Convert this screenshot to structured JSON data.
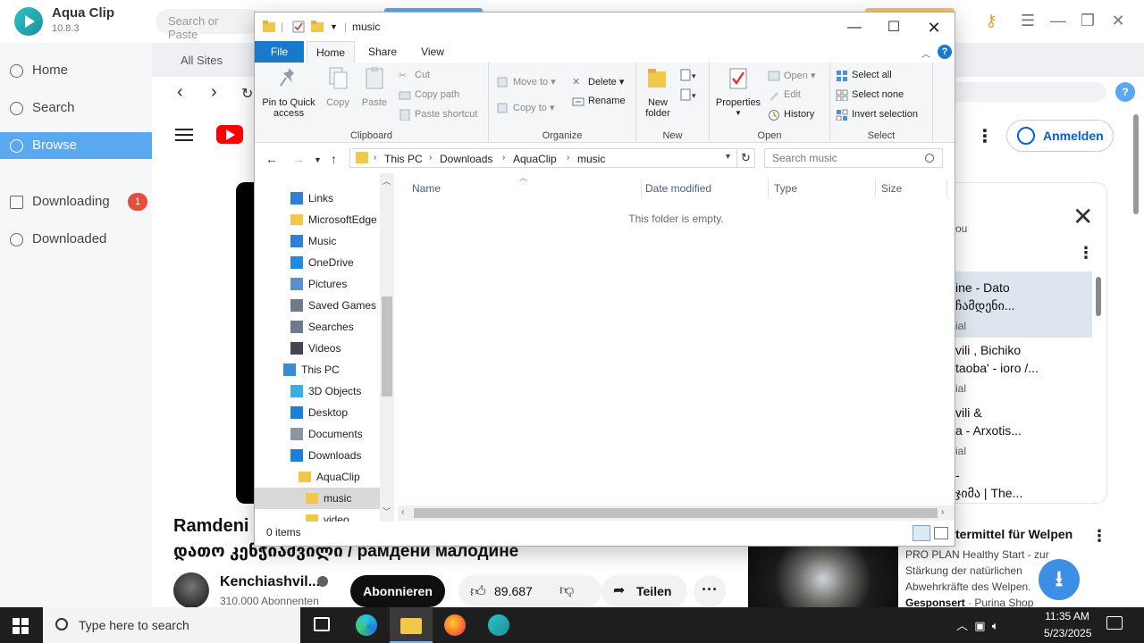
{
  "aquaclip": {
    "app_name": "Aqua Clip",
    "version": "10.8.3",
    "search_placeholder": "Search or Paste",
    "nav": [
      {
        "label": "Home",
        "icon": "home-icon"
      },
      {
        "label": "Search",
        "icon": "search-icon"
      },
      {
        "label": "Browse",
        "icon": "browse-icon",
        "active": true
      },
      {
        "label": "Downloading",
        "icon": "download-icon",
        "badge": "1"
      },
      {
        "label": "Downloaded",
        "icon": "check-circle-icon"
      }
    ],
    "tab_label": "All Sites",
    "accent_color": "#5aa8f0"
  },
  "youtube": {
    "signin_label": "Anmelden",
    "video_title_line1": "Ramdeni M",
    "video_title_line2": "დათო კენჭიაშვილი / рамдени малодине",
    "channel_name": "Kenchiashvil...",
    "subscribers": "310.000 Abonnenten",
    "subscribe_label": "Abonnieren",
    "likes": "89.687",
    "share_label": "Teilen",
    "panel_fragment": "ou",
    "playlist": [
      {
        "title": "ine - Dato",
        "title2": "ჩამდენი...",
        "sub": "ial"
      },
      {
        "title": "vili , Bichiko",
        "title2": "taoba' - ioro /...",
        "sub": "ial"
      },
      {
        "title": "vili &",
        "title2": "a - Arxotis...",
        "sub": "ial"
      },
      {
        "title": "-",
        "title2": "ჯიმა | The...",
        "sub": ""
      }
    ],
    "ad": {
      "title": "termittel für Welpen",
      "line1": "PRO PLAN Healthy Start - zur",
      "line2": "Stärkung der natürlichen",
      "line3": "Abwehrkräfte des Welpen.",
      "sponsored_prefix": "Gesponsert",
      "sponsor": "Purina Shop"
    },
    "brand_color": "#ff0000"
  },
  "explorer": {
    "window_title": "music",
    "tabs": {
      "file": "File",
      "home": "Home",
      "share": "Share",
      "view": "View"
    },
    "ribbon": {
      "clipboard": {
        "label": "Clipboard",
        "pin": "Pin to Quick access",
        "copy": "Copy",
        "paste": "Paste",
        "cut": "Cut",
        "copy_path": "Copy path",
        "paste_shortcut": "Paste shortcut"
      },
      "organize": {
        "label": "Organize",
        "move_to": "Move to",
        "copy_to": "Copy to",
        "delete": "Delete",
        "rename": "Rename"
      },
      "new": {
        "label": "New",
        "new_folder": "New folder"
      },
      "open": {
        "label": "Open",
        "properties": "Properties",
        "open": "Open",
        "edit": "Edit",
        "history": "History"
      },
      "select": {
        "label": "Select",
        "select_all": "Select all",
        "select_none": "Select none",
        "invert": "Invert selection"
      }
    },
    "breadcrumb": [
      "This PC",
      "Downloads",
      "AquaClip",
      "music"
    ],
    "search_placeholder": "Search music",
    "tree": [
      {
        "label": "Links",
        "icon": "links-icon",
        "indent": 1
      },
      {
        "label": "MicrosoftEdge",
        "icon": "folder-icon",
        "indent": 1
      },
      {
        "label": "Music",
        "icon": "music-icon",
        "indent": 1
      },
      {
        "label": "OneDrive",
        "icon": "onedrive-icon",
        "indent": 1
      },
      {
        "label": "Pictures",
        "icon": "pictures-icon",
        "indent": 1
      },
      {
        "label": "Saved Games",
        "icon": "saved-games-icon",
        "indent": 1
      },
      {
        "label": "Searches",
        "icon": "searches-icon",
        "indent": 1
      },
      {
        "label": "Videos",
        "icon": "videos-icon",
        "indent": 1
      },
      {
        "label": "This PC",
        "icon": "this-pc-icon",
        "indent": 0
      },
      {
        "label": "3D Objects",
        "icon": "3d-objects-icon",
        "indent": 1
      },
      {
        "label": "Desktop",
        "icon": "desktop-icon",
        "indent": 1
      },
      {
        "label": "Documents",
        "icon": "documents-icon",
        "indent": 1
      },
      {
        "label": "Downloads",
        "icon": "downloads-icon",
        "indent": 1
      },
      {
        "label": "AquaClip",
        "icon": "folder-icon",
        "indent": 2
      },
      {
        "label": "music",
        "icon": "folder-icon",
        "indent": 3,
        "selected": true
      },
      {
        "label": "video",
        "icon": "folder-icon",
        "indent": 3
      }
    ],
    "columns": [
      "Name",
      "Date modified",
      "Type",
      "Size"
    ],
    "empty_message": "This folder is empty.",
    "status_items": "0 items",
    "accent_color": "#1979ca"
  },
  "taskbar": {
    "search_placeholder": "Type here to search",
    "time": "11:35 AM",
    "date": "5/23/2025",
    "apps": [
      "task-view-icon",
      "edge-icon",
      "file-explorer-icon",
      "firefox-icon",
      "aquaclip-icon"
    ]
  }
}
